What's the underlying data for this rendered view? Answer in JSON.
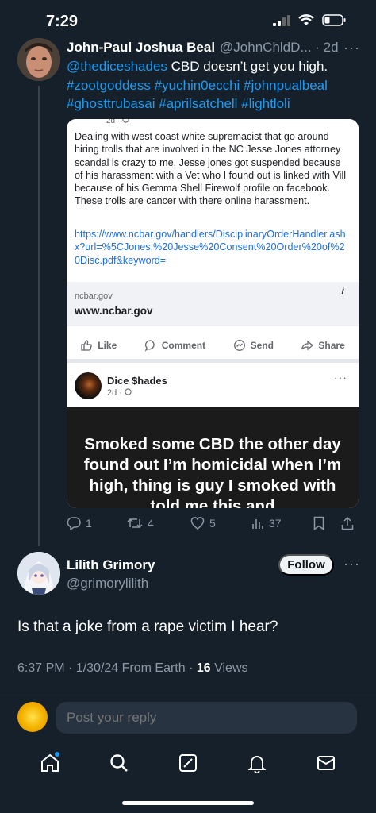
{
  "status_bar": {
    "time": "7:29"
  },
  "tweet": {
    "author_name": "John-Paul Joshua Beal",
    "author_handle_time": "@JohnChldD... · 2d",
    "mention": "@thediceshades",
    "text": " CBD doesn’t get you high.",
    "hashtags_line1": "#zootgoddess #yuchin0ecchi #johnpualbeal",
    "hashtags_line2": "#ghosttrubasai #aprilsatchell #lightloli",
    "stats": {
      "replies": "1",
      "retweets": "4",
      "likes": "5",
      "views": "37"
    }
  },
  "embedded_image": {
    "post1_meta_cut": "2d · ",
    "post1_body": "Dealing with west coast white supremacist that go around hiring trolls that are involved in the NC Jesse Jones attorney scandal is crazy to me. Jesse jones got suspended because of his harassment with a Vet who I found out is linked with Vill because of his Gemma Shell Firewolf profile on facebook. These trolls are cancer with there online harassment.",
    "post1_url": "https://www.ncbar.gov/handlers/DisciplinaryOrderHandler.ashx?url=%5CJones,%20Jesse%20Consent%20Order%20of%20Disc.pdf&keyword=",
    "link_domain_small": "ncbar.gov",
    "link_domain": "www.ncbar.gov",
    "info_glyph": "i",
    "actions": {
      "like": "Like",
      "comment": "Comment",
      "send": "Send",
      "share": "Share"
    },
    "post2_name": "Dice $hades",
    "post2_meta": "2d · ",
    "post2_text": "Smoked some CBD the other day found out I’m homicidal when I’m high, thing is guy I smoked with told me this and"
  },
  "reply": {
    "author_name": "Lilith Grimory",
    "author_handle": "@grimorylilith",
    "follow_label": "Follow",
    "text": "Is that a joke from a rape victim I hear?",
    "meta_prefix": "6:37 PM · 1/30/24 From Earth · ",
    "views_count": "16",
    "views_label": " Views"
  },
  "compose": {
    "placeholder": "Post your reply"
  },
  "colors": {
    "background": "#15202b",
    "accent": "#1d9bf0",
    "muted": "#8b98a5"
  }
}
